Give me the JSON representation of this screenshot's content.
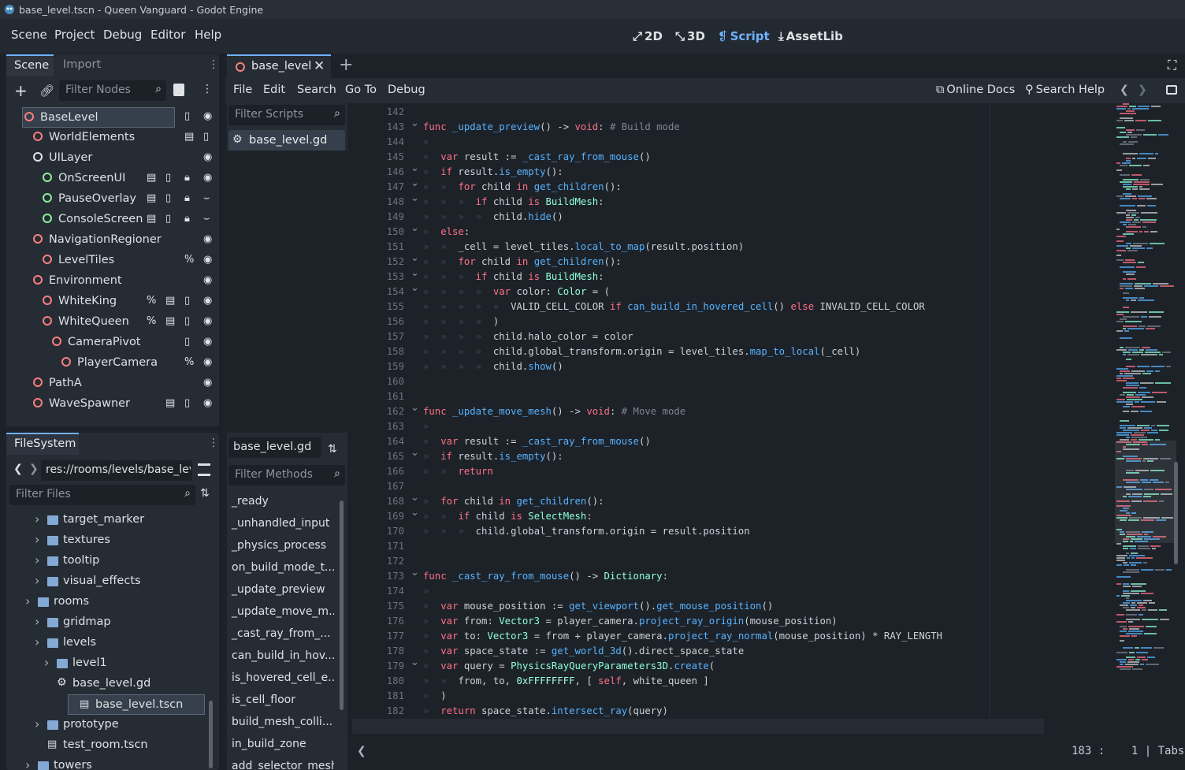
{
  "window": {
    "title": "base_level.tscn - Queen Vanguard - Godot Engine"
  },
  "menu": [
    "Scene",
    "Project",
    "Debug",
    "Editor",
    "Help"
  ],
  "workspaces": [
    {
      "label": "2D",
      "active": false
    },
    {
      "label": "3D",
      "active": false
    },
    {
      "label": "Script",
      "active": true
    },
    {
      "label": "AssetLib",
      "active": false
    }
  ],
  "scene_dock": {
    "tabs": [
      "Scene",
      "Import"
    ],
    "filter_placeholder": "Filter Nodes",
    "nodes": [
      {
        "label": "BaseLevel",
        "depth": 0,
        "selected": true
      },
      {
        "label": "WorldElements",
        "depth": 1
      },
      {
        "label": "UILayer",
        "depth": 1
      },
      {
        "label": "OnScreenUI",
        "depth": 2
      },
      {
        "label": "PauseOverlay",
        "depth": 2
      },
      {
        "label": "ConsoleScreen",
        "depth": 2
      },
      {
        "label": "NavigationRegioner",
        "depth": 1
      },
      {
        "label": "LevelTiles",
        "depth": 2
      },
      {
        "label": "Environment",
        "depth": 1
      },
      {
        "label": "WhiteKing",
        "depth": 2
      },
      {
        "label": "WhiteQueen",
        "depth": 2
      },
      {
        "label": "CameraPivot",
        "depth": 3
      },
      {
        "label": "PlayerCamera",
        "depth": 4
      },
      {
        "label": "PathA",
        "depth": 1
      },
      {
        "label": "WaveSpawner",
        "depth": 1
      }
    ]
  },
  "filesystem_dock": {
    "title": "FileSystem",
    "path": "res://rooms/levels/base_lev",
    "filter_placeholder": "Filter Files",
    "items": [
      {
        "label": "target_marker",
        "type": "folder",
        "depth": 1
      },
      {
        "label": "textures",
        "type": "folder",
        "depth": 1
      },
      {
        "label": "tooltip",
        "type": "folder",
        "depth": 1
      },
      {
        "label": "visual_effects",
        "type": "folder",
        "depth": 1
      },
      {
        "label": "rooms",
        "type": "folder",
        "depth": 0
      },
      {
        "label": "gridmap",
        "type": "folder",
        "depth": 1
      },
      {
        "label": "levels",
        "type": "folder",
        "depth": 1
      },
      {
        "label": "level1",
        "type": "folder",
        "depth": 2
      },
      {
        "label": "base_level.gd",
        "type": "script",
        "depth": 2
      },
      {
        "label": "base_level.tscn",
        "type": "scene",
        "depth": 2,
        "selected": true
      },
      {
        "label": "prototype",
        "type": "folder",
        "depth": 1
      },
      {
        "label": "test_room.tscn",
        "type": "scene",
        "depth": 1
      },
      {
        "label": "towers",
        "type": "folder",
        "depth": 0
      }
    ]
  },
  "editor_tab": {
    "label": "base_level"
  },
  "script_menu": [
    "File",
    "Edit",
    "Search",
    "Go To",
    "Debug"
  ],
  "script_help": {
    "online_docs": "Online Docs",
    "search_help": "Search Help"
  },
  "script_list": {
    "filter_placeholder": "Filter Scripts",
    "scripts": [
      "base_level.gd"
    ],
    "current": "base_level.gd",
    "methods_placeholder": "Filter Methods",
    "methods": [
      "_ready",
      "_unhandled_input",
      "_physics_process",
      "on_build_mode_t...",
      "_update_preview",
      "_update_move_m...",
      "_cast_ray_from_...",
      "can_build_in_hov...",
      "is_hovered_cell_e...",
      "is_cell_floor",
      "build_mesh_colli...",
      "in_build_zone",
      "add_selector_mesh"
    ]
  },
  "code": [
    {
      "n": "142",
      "t": ""
    },
    {
      "n": "143",
      "t": "func _update_preview() -> void: # Build mode"
    },
    {
      "n": "144",
      "t": ""
    },
    {
      "n": "145",
      "t": "    var result := _cast_ray_from_mouse()"
    },
    {
      "n": "146",
      "t": "    if result.is_empty():"
    },
    {
      "n": "147",
      "t": "        for child in get_children():"
    },
    {
      "n": "148",
      "t": "            if child is BuildMesh:"
    },
    {
      "n": "149",
      "t": "                child.hide()"
    },
    {
      "n": "150",
      "t": "    else:"
    },
    {
      "n": "151",
      "t": "        _cell = level_tiles.local_to_map(result.position)"
    },
    {
      "n": "152",
      "t": "        for child in get_children():"
    },
    {
      "n": "153",
      "t": "            if child is BuildMesh:"
    },
    {
      "n": "154",
      "t": "                var color: Color = ("
    },
    {
      "n": "155",
      "t": "                    VALID_CELL_COLOR if can_build_in_hovered_cell() else INVALID_CELL_COLOR"
    },
    {
      "n": "156",
      "t": "                )"
    },
    {
      "n": "157",
      "t": "                child.halo_color = color"
    },
    {
      "n": "158",
      "t": "                child.global_transform.origin = level_tiles.map_to_local(_cell)"
    },
    {
      "n": "159",
      "t": "                child.show()"
    },
    {
      "n": "160",
      "t": ""
    },
    {
      "n": "161",
      "t": ""
    },
    {
      "n": "162",
      "t": "func _update_move_mesh() -> void: # Move mode"
    },
    {
      "n": "163",
      "t": ""
    },
    {
      "n": "164",
      "t": "    var result := _cast_ray_from_mouse()"
    },
    {
      "n": "165",
      "t": "    if result.is_empty():"
    },
    {
      "n": "166",
      "t": "        return"
    },
    {
      "n": "167",
      "t": ""
    },
    {
      "n": "168",
      "t": "    for child in get_children():"
    },
    {
      "n": "169",
      "t": "        if child is SelectMesh:"
    },
    {
      "n": "170",
      "t": "            child.global_transform.origin = result.position"
    },
    {
      "n": "171",
      "t": ""
    },
    {
      "n": "172",
      "t": ""
    },
    {
      "n": "173",
      "t": "func _cast_ray_from_mouse() -> Dictionary:"
    },
    {
      "n": "174",
      "t": ""
    },
    {
      "n": "175",
      "t": "    var mouse_position := get_viewport().get_mouse_position()"
    },
    {
      "n": "176",
      "t": "    var from: Vector3 = player_camera.project_ray_origin(mouse_position)"
    },
    {
      "n": "177",
      "t": "    var to: Vector3 = from + player_camera.project_ray_normal(mouse_position) * RAY_LENGTH"
    },
    {
      "n": "178",
      "t": "    var space_state := get_world_3d().direct_space_state"
    },
    {
      "n": "179",
      "t": "    var query = PhysicsRayQueryParameters3D.create("
    },
    {
      "n": "180",
      "t": "        from, to, 0xFFFFFFFF, [ self, white_queen ]"
    },
    {
      "n": "181",
      "t": "    )"
    },
    {
      "n": "182",
      "t": "    return space_state.intersect_ray(query)"
    },
    {
      "n": "183",
      "t": ""
    }
  ],
  "status": {
    "line": "183",
    "col": "1",
    "indent": "Tabs"
  },
  "colors": {
    "accent": "#6fb2ff",
    "keyword": "#ff7085",
    "function": "#57b3ff",
    "type": "#8effda",
    "comment": "#7d8590"
  }
}
